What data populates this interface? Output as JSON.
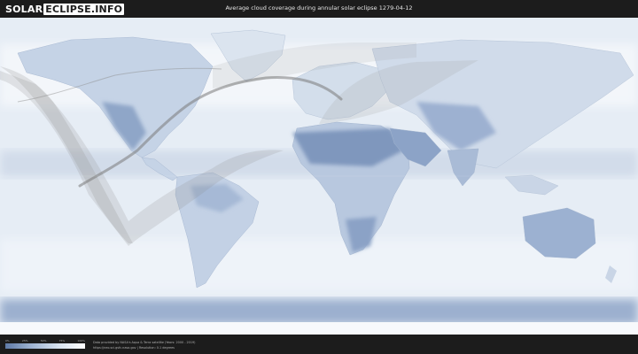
{
  "header": {
    "logo_solar": "SOLAR",
    "logo_eclipse": "ECLIPSE.INFO",
    "title": "Average cloud coverage during annular solar eclipse 1279-04-12"
  },
  "legend": {
    "ticks": [
      "0%",
      "25%",
      "50%",
      "75%",
      "100%"
    ],
    "color_low": "#5f7aa6",
    "color_high": "#ffffff"
  },
  "footer": {
    "credit_line1": "Data provided by NASA's Aqua & Terra satellite (Years: 2000 - 2019)",
    "credit_line2": "https://neo.sci.gsfc.nasa.gov | Resolution: 0.1 degrees"
  },
  "colors": {
    "ocean": "#e8eef6",
    "land": "#cdd9e8",
    "cloud_dark": "#8ea4c7",
    "eclipse_path": "#7a7a7a"
  }
}
